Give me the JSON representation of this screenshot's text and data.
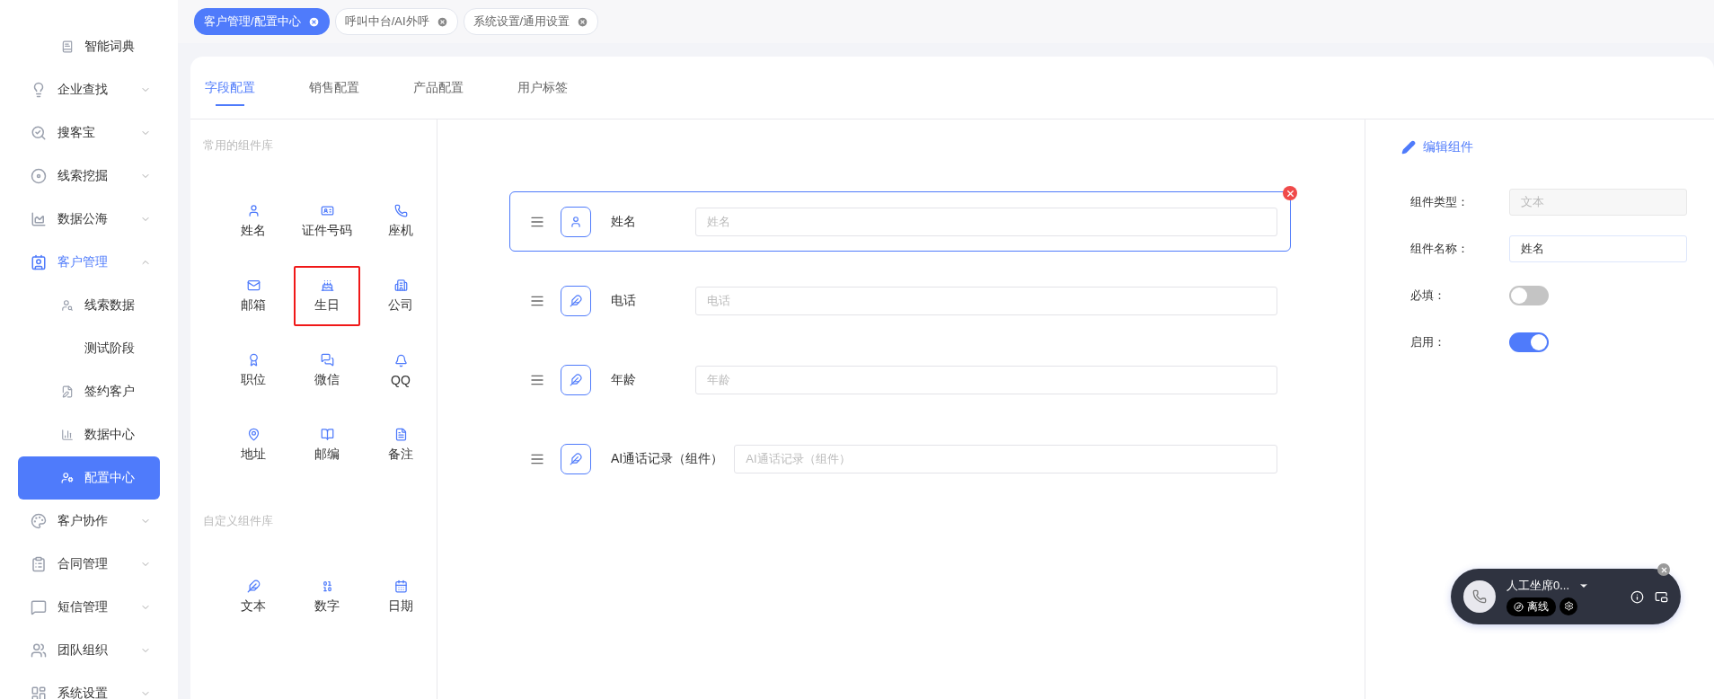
{
  "sidebar": {
    "scrolled_children": [
      {
        "label": "智能词典",
        "selected": false
      }
    ],
    "items": [
      {
        "label": "企业查找",
        "expanded": false,
        "selected": false
      },
      {
        "label": "搜客宝",
        "expanded": false,
        "selected": false
      },
      {
        "label": "线索挖掘",
        "expanded": false,
        "selected": false
      },
      {
        "label": "数据公海",
        "expanded": false,
        "selected": false
      },
      {
        "label": "客户管理",
        "expanded": true,
        "selected": false,
        "children": [
          {
            "label": "线索数据",
            "selected": false
          },
          {
            "label": "测试阶段",
            "selected": false
          },
          {
            "label": "签约客户",
            "selected": false
          },
          {
            "label": "数据中心",
            "selected": false
          },
          {
            "label": "配置中心",
            "selected": true
          }
        ]
      },
      {
        "label": "客户协作",
        "expanded": false,
        "selected": false
      },
      {
        "label": "合同管理",
        "expanded": false,
        "selected": false
      },
      {
        "label": "短信管理",
        "expanded": false,
        "selected": false
      },
      {
        "label": "团队组织",
        "expanded": false,
        "selected": false
      },
      {
        "label": "系统设置",
        "expanded": false,
        "selected": false
      }
    ]
  },
  "page_tabs": [
    {
      "label": "客户管理/配置中心",
      "selected": true
    },
    {
      "label": "呼叫中台/AI外呼",
      "selected": false
    },
    {
      "label": "系统设置/通用设置",
      "selected": false
    }
  ],
  "config_tabs": [
    {
      "label": "字段配置",
      "selected": true
    },
    {
      "label": "销售配置",
      "selected": false
    },
    {
      "label": "产品配置",
      "selected": false
    },
    {
      "label": "用户标签",
      "selected": false
    }
  ],
  "common_library": {
    "title": "常用的组件库",
    "items": [
      {
        "label": "姓名",
        "highlighted": false
      },
      {
        "label": "证件号码",
        "highlighted": false
      },
      {
        "label": "座机",
        "highlighted": false
      },
      {
        "label": "邮箱",
        "highlighted": false
      },
      {
        "label": "生日",
        "highlighted": true
      },
      {
        "label": "公司",
        "highlighted": false
      },
      {
        "label": "职位",
        "highlighted": false
      },
      {
        "label": "微信",
        "highlighted": false
      },
      {
        "label": "QQ",
        "highlighted": false
      },
      {
        "label": "地址",
        "highlighted": false
      },
      {
        "label": "邮编",
        "highlighted": false
      },
      {
        "label": "备注",
        "highlighted": false
      }
    ]
  },
  "custom_library": {
    "title": "自定义组件库",
    "items": [
      {
        "label": "文本",
        "highlighted": false
      },
      {
        "label": "数字",
        "highlighted": false
      },
      {
        "label": "日期",
        "highlighted": false
      }
    ]
  },
  "form_fields": [
    {
      "kind": "person",
      "label": "姓名",
      "placeholder": "姓名",
      "selected": true
    },
    {
      "kind": "text",
      "label": "电话",
      "placeholder": "电话",
      "selected": false
    },
    {
      "kind": "text",
      "label": "年龄",
      "placeholder": "年龄",
      "selected": false
    },
    {
      "kind": "text",
      "label": "AI通话记录（组件）",
      "placeholder": "AI通话记录（组件）",
      "selected": false
    }
  ],
  "editor": {
    "title": "编辑组件",
    "type_label": "组件类型：",
    "type_value": "文本",
    "type_disabled": true,
    "name_label": "组件名称：",
    "name_value": "姓名",
    "switches": [
      {
        "label": "必填：",
        "on": false
      },
      {
        "label": "启用：",
        "on": true
      }
    ]
  },
  "call_widget": {
    "agent": "人工坐席0...",
    "status": "离线"
  }
}
